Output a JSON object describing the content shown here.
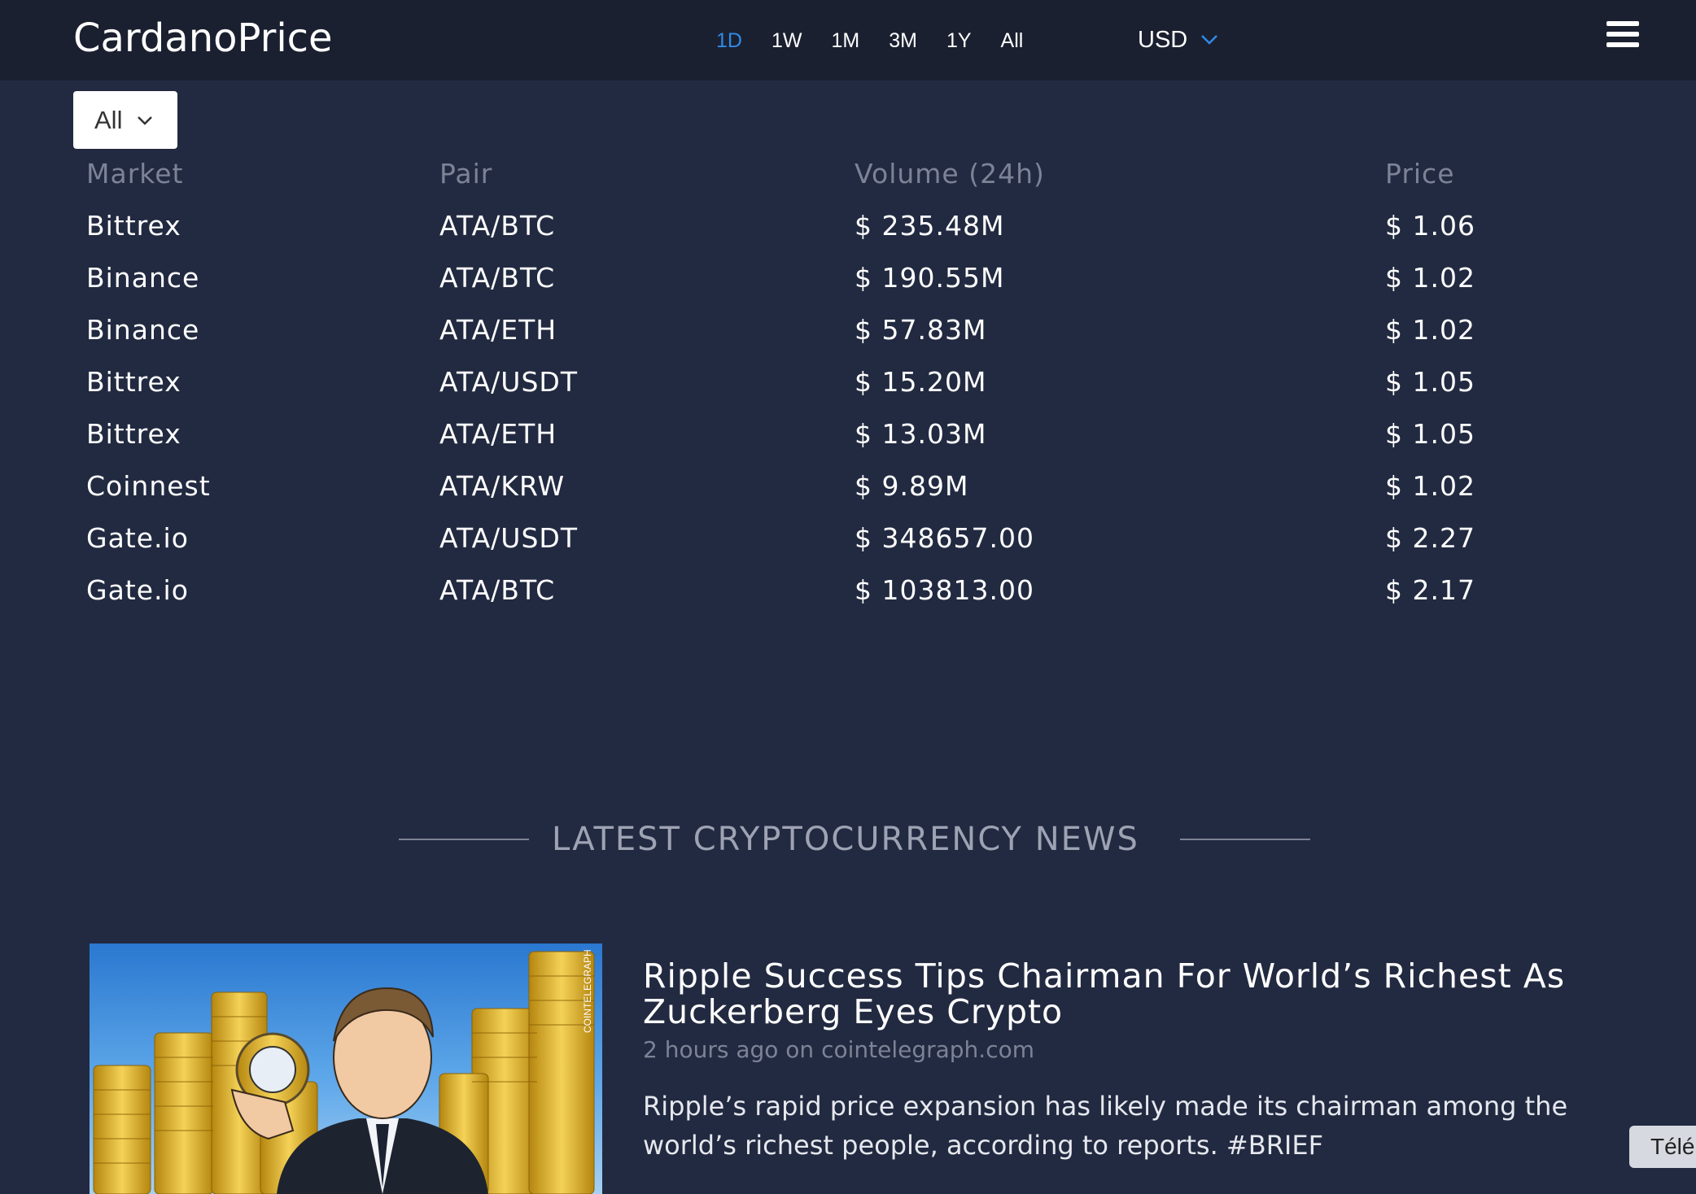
{
  "header": {
    "logo": "CardanoPrice",
    "ranges": [
      "1D",
      "1W",
      "1M",
      "3M",
      "1Y",
      "All"
    ],
    "active_range": "1D",
    "currency": "USD",
    "accent_color": "#2f8be6"
  },
  "filter": {
    "selected": "All"
  },
  "markets_table": {
    "columns": [
      "Market",
      "Pair",
      "Volume (24h)",
      "Price"
    ],
    "rows": [
      [
        "Bittrex",
        "ATA/BTC",
        "$ 235.48M",
        "$ 1.06"
      ],
      [
        "Binance",
        "ATA/BTC",
        "$ 190.55M",
        "$ 1.02"
      ],
      [
        "Binance",
        "ATA/ETH",
        "$ 57.83M",
        "$ 1.02"
      ],
      [
        "Bittrex",
        "ATA/USDT",
        "$ 15.20M",
        "$ 1.05"
      ],
      [
        "Bittrex",
        "ATA/ETH",
        "$ 13.03M",
        "$ 1.05"
      ],
      [
        "Coinnest",
        "ATA/KRW",
        "$ 9.89M",
        "$ 1.02"
      ],
      [
        "Gate.io",
        "ATA/USDT",
        "$ 348657.00",
        "$ 2.27"
      ],
      [
        "Gate.io",
        "ATA/BTC",
        "$ 103813.00",
        "$ 2.17"
      ]
    ]
  },
  "news": {
    "heading": "LATEST CRYPTOCURRENCY NEWS",
    "article": {
      "title": "Ripple Success Tips Chairman For World’s Richest As Zuckerberg Eyes Crypto",
      "meta": "2 hours ago on cointelegraph.com",
      "body": "Ripple’s rapid price expansion has likely made its chairman among the world’s richest people, according to reports. #BRIEF",
      "image_watermark": "COINTELEGRAPH"
    }
  },
  "floating_button": {
    "label": "Télé"
  }
}
